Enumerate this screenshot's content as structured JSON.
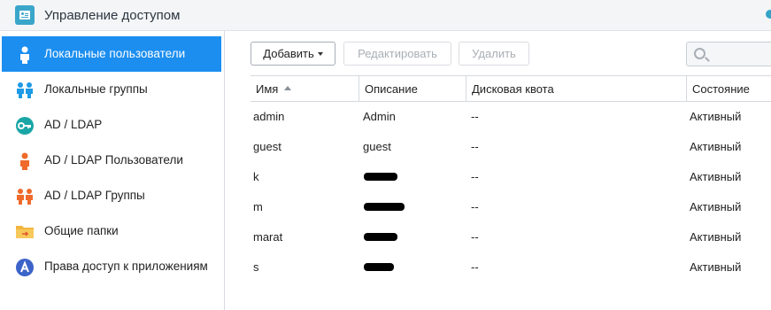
{
  "window": {
    "title": "Управление доступом",
    "accent": "#1b8ef0"
  },
  "sidebar": {
    "items": [
      {
        "label": "Локальные пользователи",
        "icon": "user-icon",
        "active": true
      },
      {
        "label": "Локальные группы",
        "icon": "group-icon",
        "active": false
      },
      {
        "label": "AD / LDAP",
        "icon": "key-icon",
        "active": false
      },
      {
        "label": "AD / LDAP Пользователи",
        "icon": "user-icon",
        "active": false
      },
      {
        "label": "AD / LDAP Группы",
        "icon": "group-icon",
        "active": false
      },
      {
        "label": "Общие папки",
        "icon": "folder-icon",
        "active": false
      },
      {
        "label": "Права доступ к приложениям",
        "icon": "app-icon",
        "active": false
      }
    ]
  },
  "toolbar": {
    "add_label": "Добавить",
    "edit_label": "Редактировать",
    "delete_label": "Удалить",
    "search_placeholder": ""
  },
  "table": {
    "columns": [
      "Имя",
      "Описание",
      "Дисковая квота",
      "Состояние"
    ],
    "rows": [
      {
        "name": "admin",
        "description": "Admin",
        "quota": "--",
        "status": "Активный"
      },
      {
        "name": "guest",
        "description": "guest",
        "quota": "--",
        "status": "Активный"
      },
      {
        "name": "k",
        "description": "",
        "quota": "--",
        "status": "Активный"
      },
      {
        "name": "m",
        "description": "",
        "quota": "--",
        "status": "Активный"
      },
      {
        "name": "marat",
        "description": "",
        "quota": "--",
        "status": "Активный"
      },
      {
        "name": "s",
        "description": "",
        "quota": "--",
        "status": "Активный"
      }
    ]
  }
}
